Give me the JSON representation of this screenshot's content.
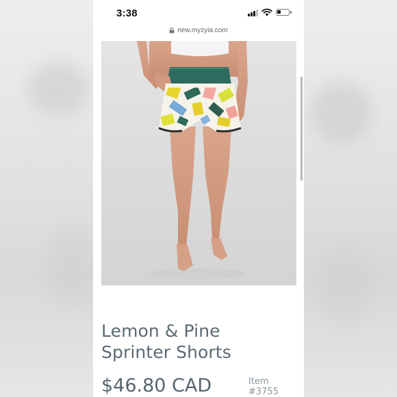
{
  "status_bar": {
    "time": "3:38",
    "signal_icon": "cellular-signal-icon",
    "wifi_icon": "wifi-icon",
    "battery_icon": "battery-icon",
    "battery_level": 0.35
  },
  "browser": {
    "lock_icon": "lock-icon",
    "url": "new.myzyia.com"
  },
  "product": {
    "image_icon": "product-photo",
    "title": "Lemon & Pine Sprinter Shorts",
    "price": "$46.80 CAD",
    "item_label": "Item",
    "item_number": "#3755"
  },
  "colors": {
    "waistband": "#2e6b5e",
    "text": "#5b6a72",
    "background": "#ffffff"
  }
}
